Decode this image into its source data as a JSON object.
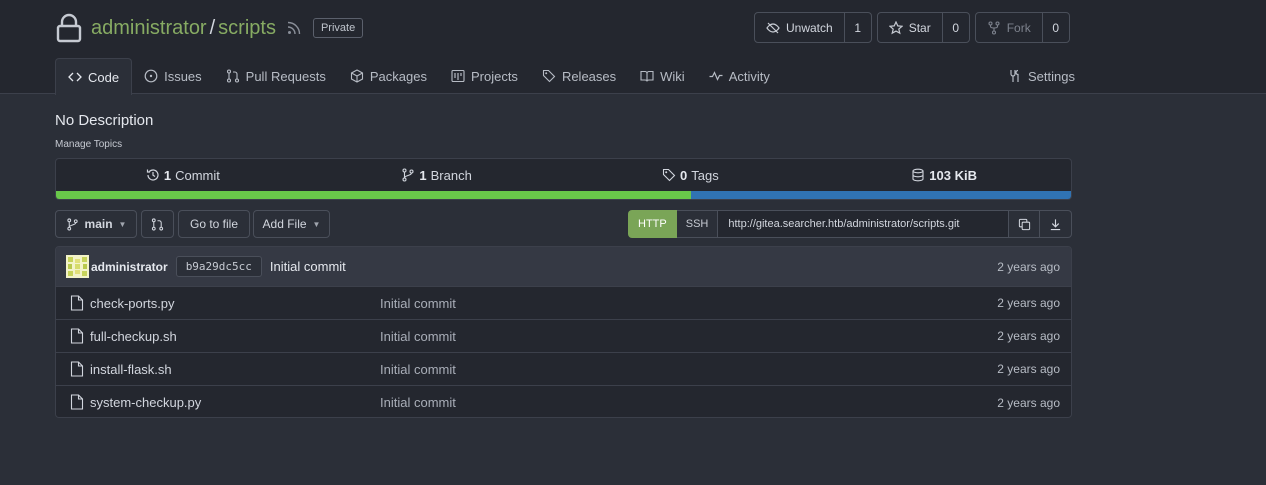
{
  "repo": {
    "owner": "administrator",
    "separator": "/",
    "name": "scripts",
    "visibility": "Private",
    "description": "No Description",
    "manage_topics": "Manage Topics"
  },
  "actions": {
    "unwatch": {
      "label": "Unwatch",
      "count": "1"
    },
    "star": {
      "label": "Star",
      "count": "0"
    },
    "fork": {
      "label": "Fork",
      "count": "0"
    }
  },
  "tabs": [
    {
      "label": "Code",
      "icon": "code-icon"
    },
    {
      "label": "Issues",
      "icon": "issue-icon"
    },
    {
      "label": "Pull Requests",
      "icon": "pull-request-icon"
    },
    {
      "label": "Packages",
      "icon": "package-icon"
    },
    {
      "label": "Projects",
      "icon": "project-icon"
    },
    {
      "label": "Releases",
      "icon": "tag-icon"
    },
    {
      "label": "Wiki",
      "icon": "book-icon"
    },
    {
      "label": "Activity",
      "icon": "pulse-icon"
    }
  ],
  "settings_tab": {
    "label": "Settings",
    "icon": "tools-icon"
  },
  "stats": {
    "commits": {
      "count": "1",
      "label": "Commit"
    },
    "branches": {
      "count": "1",
      "label": "Branch"
    },
    "tags": {
      "count": "0",
      "label": "Tags"
    },
    "size": {
      "count": "103 KiB"
    }
  },
  "languages": {
    "python_fraction": 0.626,
    "shell_fraction": 0.374,
    "python_color": "#69c74a",
    "shell_color": "#3073b3"
  },
  "toolbar": {
    "branch": "main",
    "go_to_file": "Go to file",
    "add_file": "Add File",
    "clone_http": "HTTP",
    "clone_ssh": "SSH",
    "clone_url": "http://gitea.searcher.htb/administrator/scripts.git"
  },
  "latest_commit": {
    "author": "administrator",
    "sha": "b9a29dc5cc",
    "message": "Initial commit",
    "age": "2 years ago"
  },
  "files": [
    {
      "name": "check-ports.py",
      "message": "Initial commit",
      "age": "2 years ago"
    },
    {
      "name": "full-checkup.sh",
      "message": "Initial commit",
      "age": "2 years ago"
    },
    {
      "name": "install-flask.sh",
      "message": "Initial commit",
      "age": "2 years ago"
    },
    {
      "name": "system-checkup.py",
      "message": "Initial commit",
      "age": "2 years ago"
    }
  ],
  "colors": {
    "accent": "#87ab63",
    "http_button": "#7aa557",
    "background": "#2b2f38",
    "header": "#24272f"
  }
}
